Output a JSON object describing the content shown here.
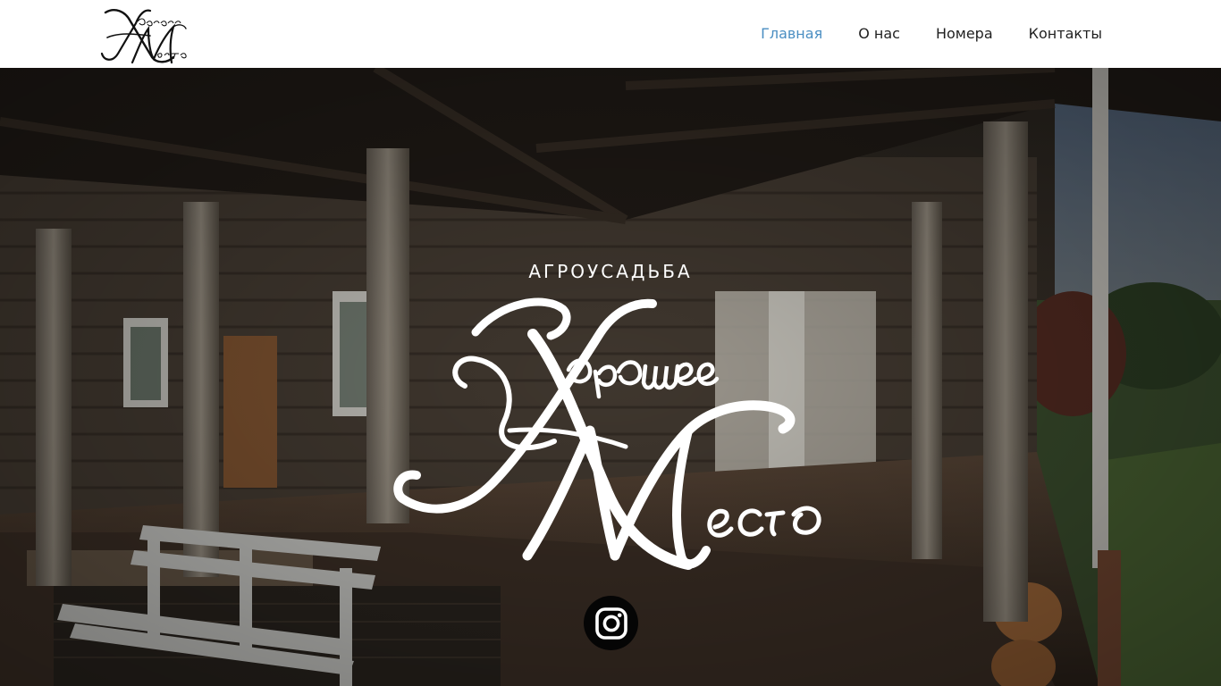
{
  "header": {
    "logo": {
      "text": "Хорошее Место",
      "alt": "logo-icon"
    },
    "nav": [
      {
        "label": "Главная",
        "active": true
      },
      {
        "label": "О нас",
        "active": false
      },
      {
        "label": "Номера",
        "active": false
      },
      {
        "label": "Контакты",
        "active": false
      }
    ]
  },
  "hero": {
    "tagline": "АГРОУСАДЬБА",
    "title": "Хорошее Место",
    "social": {
      "icon": "instagram-icon"
    }
  },
  "colors": {
    "header_bg": "#ffffff",
    "nav_text": "#1f1f1f",
    "nav_active": "#4a8ec2",
    "hero_text": "#ffffff",
    "insta_bg": "#050505"
  }
}
